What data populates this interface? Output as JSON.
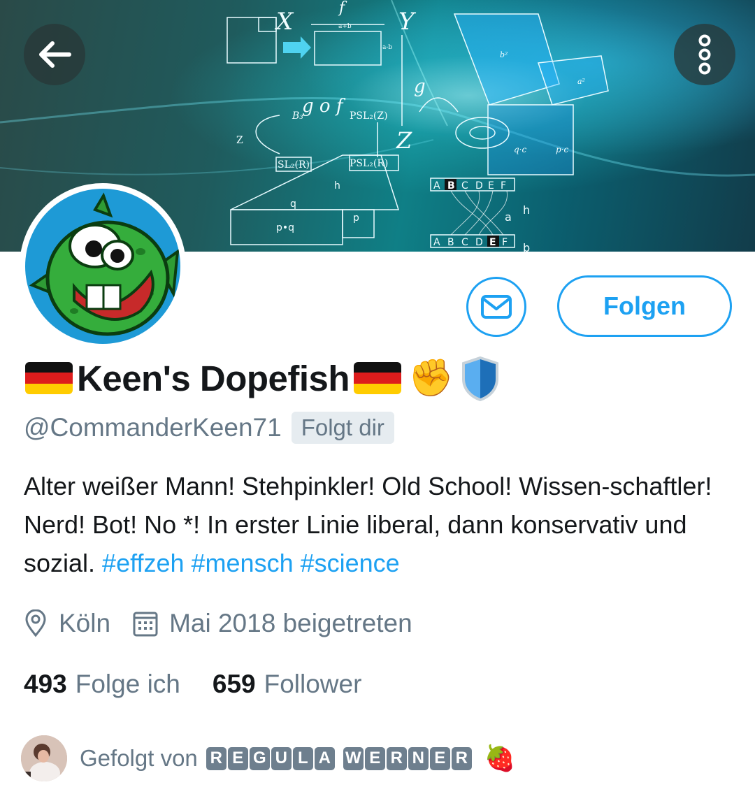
{
  "header": {
    "back_icon": "arrow-left-icon",
    "more_icon": "more-vertical-icon",
    "banner_labels": [
      "X",
      "f",
      "Y",
      "a+b",
      "a-b",
      "g",
      "g o f",
      "PSL2(Z)",
      "B3",
      "Z",
      "SL2(R)",
      "PSL2(R)",
      "p•q",
      "q·c",
      "p·c",
      "a²",
      "b²",
      "h",
      "p",
      "q",
      "a",
      "b",
      "A",
      "B",
      "C",
      "D",
      "E",
      "F"
    ]
  },
  "actions": {
    "message_icon": "envelope-icon",
    "follow_label": "Folgen"
  },
  "profile": {
    "display_name": "Keen's Dopefish",
    "name_emojis": [
      "flag-germany",
      "flag-germany",
      "raised-fist",
      "shield"
    ],
    "fist_emoji": "✊",
    "handle": "@CommanderKeen71",
    "follows_you_label": "Folgt dir",
    "bio_text": "Alter weißer Mann! Stehpinkler! Old School! Wissen-schaftler! Nerd! Bot! No *! In erster Linie liberal, dann konservativ und sozial. ",
    "hashtags": [
      "#effzeh",
      "#mensch",
      "#science"
    ],
    "location": "Köln",
    "location_icon": "map-pin-icon",
    "joined": "Mai 2018 beigetreten",
    "joined_icon": "calendar-icon"
  },
  "stats": {
    "following_count": "493",
    "following_label": "Folge ich",
    "followers_count": "659",
    "followers_label": "Follower"
  },
  "followed_by": {
    "label": "Gefolgt von",
    "name_letters_first": [
      "R",
      "E",
      "G",
      "U",
      "L",
      "A"
    ],
    "name_letters_last": [
      "W",
      "E",
      "R",
      "N",
      "E",
      "R"
    ],
    "emoji": "🍓"
  },
  "colors": {
    "accent": "#1da1f2",
    "secondary_text": "#657786",
    "primary_text": "#14171a",
    "avatar_bg": "#1e9ad6",
    "dopefish_green": "#33a93a"
  }
}
